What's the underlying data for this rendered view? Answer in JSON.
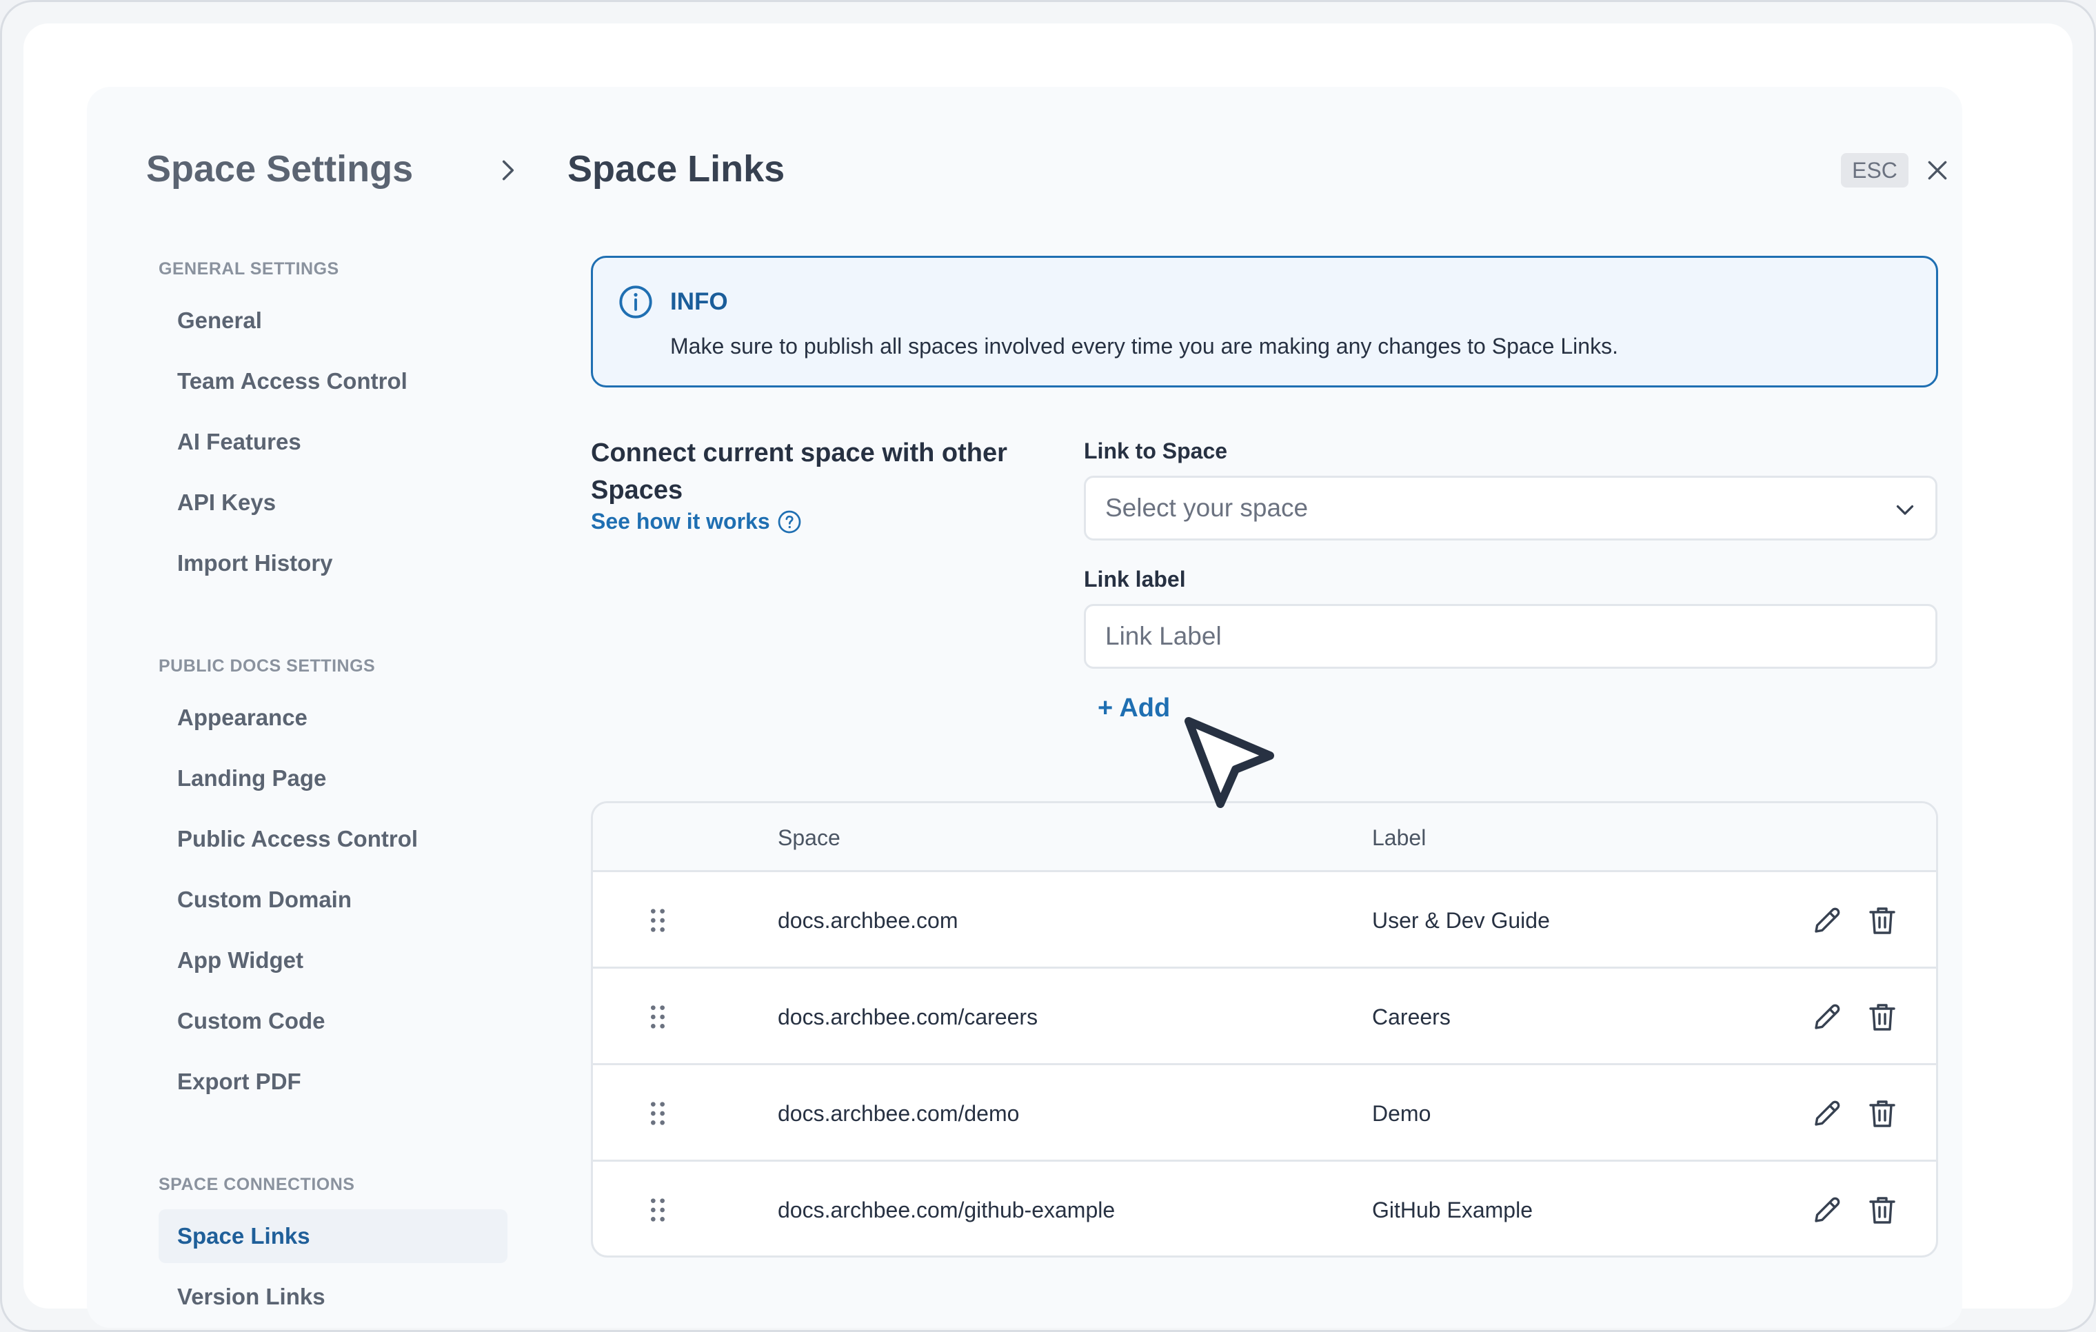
{
  "header": {
    "sidebar_title": "Space Settings",
    "page_title": "Space Links",
    "esc_label": "ESC"
  },
  "sidebar": {
    "sections": [
      {
        "title": "GENERAL SETTINGS",
        "items": [
          "General",
          "Team Access Control",
          "AI Features",
          "API Keys",
          "Import History"
        ]
      },
      {
        "title": "PUBLIC DOCS SETTINGS",
        "items": [
          "Appearance",
          "Landing Page",
          "Public Access Control",
          "Custom Domain",
          "App Widget",
          "Custom Code",
          "Export PDF"
        ]
      },
      {
        "title": "SPACE CONNECTIONS",
        "items": [
          "Space Links",
          "Version Links"
        ]
      }
    ],
    "active_item": "Space Links"
  },
  "info": {
    "title": "INFO",
    "text": "Make sure to publish all spaces involved every time you are making any changes to Space Links."
  },
  "connect": {
    "title": "Connect current space with other Spaces",
    "how_link": "See how it works",
    "space_label": "Link to Space",
    "space_placeholder": "Select your space",
    "label_label": "Link label",
    "label_placeholder": "Link Label",
    "add_label": "+ Add"
  },
  "table": {
    "columns": [
      "Space",
      "Label"
    ],
    "rows": [
      {
        "space": "docs.archbee.com",
        "label": "User & Dev Guide"
      },
      {
        "space": "docs.archbee.com/careers",
        "label": "Careers"
      },
      {
        "space": "docs.archbee.com/demo",
        "label": "Demo"
      },
      {
        "space": "docs.archbee.com/github-example",
        "label": "GitHub Example"
      }
    ]
  },
  "colors": {
    "accent": "#1f6fb2",
    "info_bg": "#f0f6fd",
    "active_nav_bg": "#eef2f7"
  },
  "icons": {
    "chevron": "chevron-right-icon",
    "close": "close-icon",
    "info": "info-icon",
    "help": "help-icon",
    "dropdown": "chevron-down-icon",
    "drag": "drag-handle-icon",
    "edit": "pencil-icon",
    "delete": "trash-icon",
    "cursor": "mouse-pointer-icon"
  }
}
